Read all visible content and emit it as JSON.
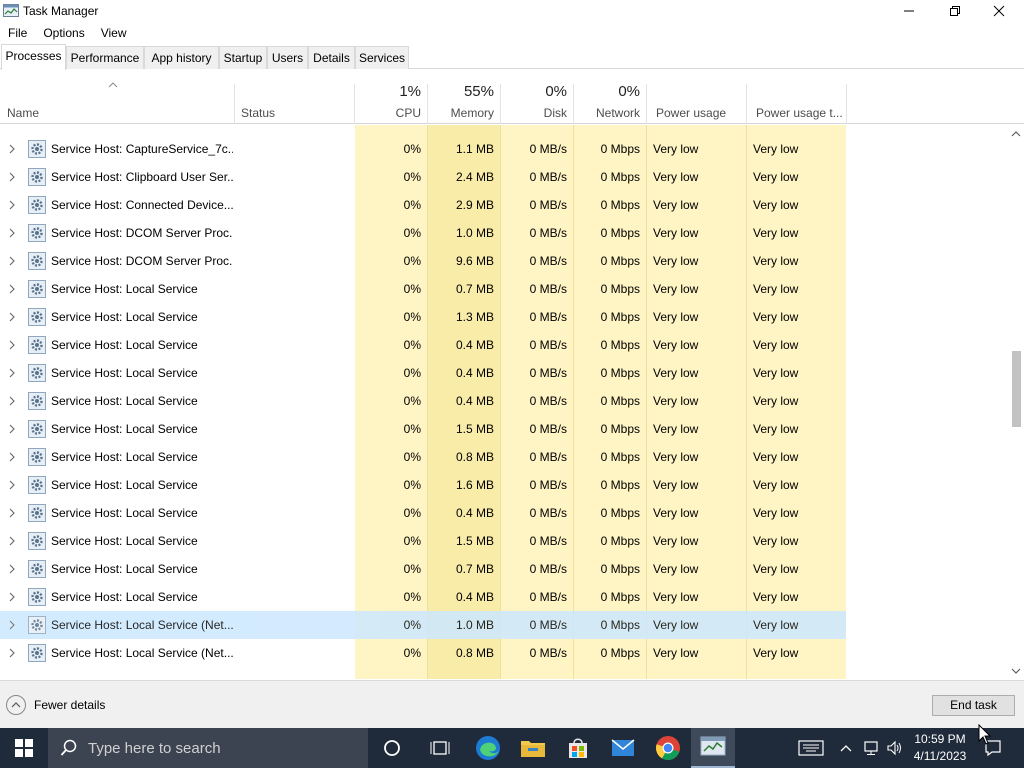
{
  "window": {
    "title": "Task Manager"
  },
  "menu": [
    "File",
    "Options",
    "View"
  ],
  "tabs": [
    "Processes",
    "Performance",
    "App history",
    "Startup",
    "Users",
    "Details",
    "Services"
  ],
  "active_tab": "Processes",
  "header": {
    "name": "Name",
    "status": "Status",
    "cpu": {
      "percent": "1%",
      "label": "CPU"
    },
    "memory": {
      "percent": "55%",
      "label": "Memory"
    },
    "disk": {
      "percent": "0%",
      "label": "Disk"
    },
    "network": {
      "percent": "0%",
      "label": "Network"
    },
    "power": "Power usage",
    "power_trend": "Power usage t..."
  },
  "processes": [
    {
      "name": "Service Host: CaptureService_7c...",
      "cpu": "0%",
      "memory": "1.1 MB",
      "disk": "0 MB/s",
      "network": "0 Mbps",
      "power": "Very low",
      "power_trend": "Very low"
    },
    {
      "name": "Service Host: Clipboard User Ser...",
      "cpu": "0%",
      "memory": "2.4 MB",
      "disk": "0 MB/s",
      "network": "0 Mbps",
      "power": "Very low",
      "power_trend": "Very low"
    },
    {
      "name": "Service Host: Connected Device...",
      "cpu": "0%",
      "memory": "2.9 MB",
      "disk": "0 MB/s",
      "network": "0 Mbps",
      "power": "Very low",
      "power_trend": "Very low"
    },
    {
      "name": "Service Host: DCOM Server Proc...",
      "cpu": "0%",
      "memory": "1.0 MB",
      "disk": "0 MB/s",
      "network": "0 Mbps",
      "power": "Very low",
      "power_trend": "Very low"
    },
    {
      "name": "Service Host: DCOM Server Proc...",
      "cpu": "0%",
      "memory": "9.6 MB",
      "disk": "0 MB/s",
      "network": "0 Mbps",
      "power": "Very low",
      "power_trend": "Very low"
    },
    {
      "name": "Service Host: Local Service",
      "cpu": "0%",
      "memory": "0.7 MB",
      "disk": "0 MB/s",
      "network": "0 Mbps",
      "power": "Very low",
      "power_trend": "Very low"
    },
    {
      "name": "Service Host: Local Service",
      "cpu": "0%",
      "memory": "1.3 MB",
      "disk": "0 MB/s",
      "network": "0 Mbps",
      "power": "Very low",
      "power_trend": "Very low"
    },
    {
      "name": "Service Host: Local Service",
      "cpu": "0%",
      "memory": "0.4 MB",
      "disk": "0 MB/s",
      "network": "0 Mbps",
      "power": "Very low",
      "power_trend": "Very low"
    },
    {
      "name": "Service Host: Local Service",
      "cpu": "0%",
      "memory": "0.4 MB",
      "disk": "0 MB/s",
      "network": "0 Mbps",
      "power": "Very low",
      "power_trend": "Very low"
    },
    {
      "name": "Service Host: Local Service",
      "cpu": "0%",
      "memory": "0.4 MB",
      "disk": "0 MB/s",
      "network": "0 Mbps",
      "power": "Very low",
      "power_trend": "Very low"
    },
    {
      "name": "Service Host: Local Service",
      "cpu": "0%",
      "memory": "1.5 MB",
      "disk": "0 MB/s",
      "network": "0 Mbps",
      "power": "Very low",
      "power_trend": "Very low"
    },
    {
      "name": "Service Host: Local Service",
      "cpu": "0%",
      "memory": "0.8 MB",
      "disk": "0 MB/s",
      "network": "0 Mbps",
      "power": "Very low",
      "power_trend": "Very low"
    },
    {
      "name": "Service Host: Local Service",
      "cpu": "0%",
      "memory": "1.6 MB",
      "disk": "0 MB/s",
      "network": "0 Mbps",
      "power": "Very low",
      "power_trend": "Very low"
    },
    {
      "name": "Service Host: Local Service",
      "cpu": "0%",
      "memory": "0.4 MB",
      "disk": "0 MB/s",
      "network": "0 Mbps",
      "power": "Very low",
      "power_trend": "Very low"
    },
    {
      "name": "Service Host: Local Service",
      "cpu": "0%",
      "memory": "1.5 MB",
      "disk": "0 MB/s",
      "network": "0 Mbps",
      "power": "Very low",
      "power_trend": "Very low"
    },
    {
      "name": "Service Host: Local Service",
      "cpu": "0%",
      "memory": "0.7 MB",
      "disk": "0 MB/s",
      "network": "0 Mbps",
      "power": "Very low",
      "power_trend": "Very low"
    },
    {
      "name": "Service Host: Local Service",
      "cpu": "0%",
      "memory": "0.4 MB",
      "disk": "0 MB/s",
      "network": "0 Mbps",
      "power": "Very low",
      "power_trend": "Very low"
    },
    {
      "name": "Service Host: Local Service (Net...",
      "cpu": "0%",
      "memory": "1.0 MB",
      "disk": "0 MB/s",
      "network": "0 Mbps",
      "power": "Very low",
      "power_trend": "Very low",
      "selected": true
    },
    {
      "name": "Service Host: Local Service (Net...",
      "cpu": "0%",
      "memory": "0.8 MB",
      "disk": "0 MB/s",
      "network": "0 Mbps",
      "power": "Very low",
      "power_trend": "Very low"
    }
  ],
  "footer": {
    "fewer_details": "Fewer details",
    "end_task": "End task"
  },
  "taskbar": {
    "search_placeholder": "Type here to search",
    "time": "10:59 PM",
    "date": "4/11/2023"
  },
  "colors": {
    "cpu_col": "#fff4c4",
    "memory_col": "#f9eca8",
    "other_col": "#fff4c4",
    "selected_row": "#cce8ff",
    "taskbar": "#1f2a3a"
  }
}
